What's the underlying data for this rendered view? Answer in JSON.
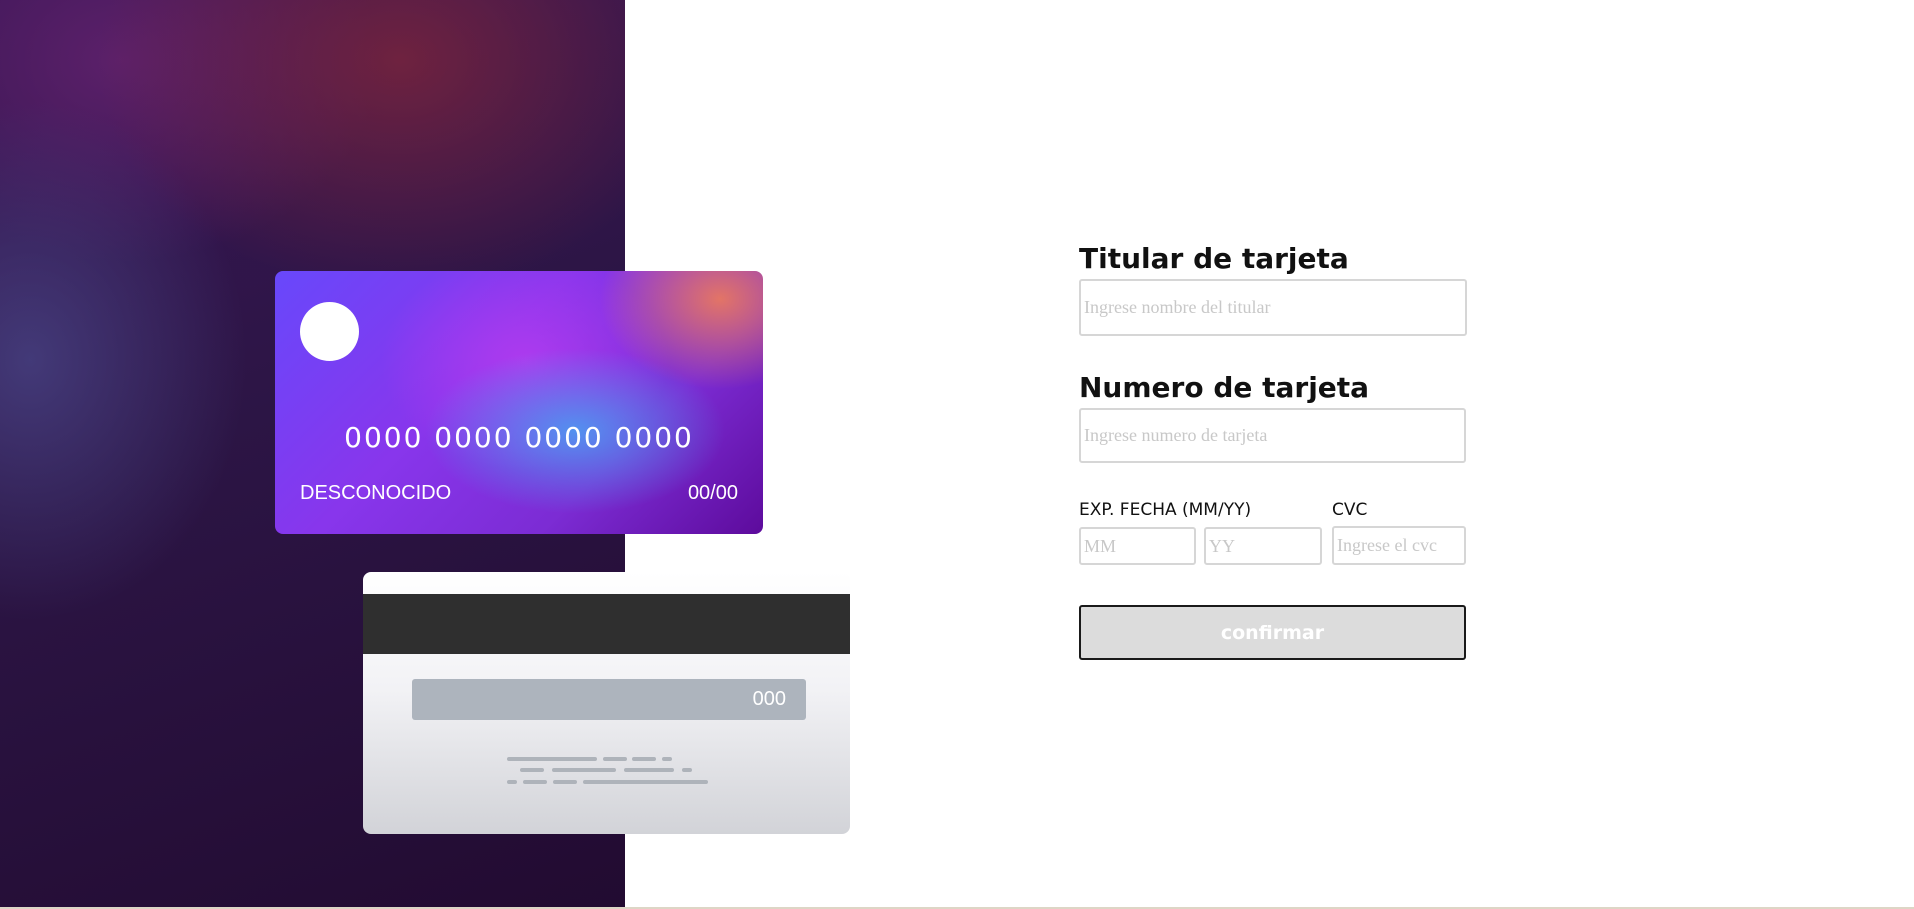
{
  "colors": {
    "card_gradient_start": "#6848fb",
    "card_gradient_end": "#5d0b9c",
    "button_bg": "#dcdcdc",
    "button_text": "#ffffff"
  },
  "card_front": {
    "number": "0000 0000 0000 0000",
    "holder": "DESCONOCIDO",
    "expiry": "00/00"
  },
  "card_back": {
    "cvc": "000"
  },
  "form": {
    "holder_label": "Titular de tarjeta",
    "holder_placeholder": "Ingrese nombre del titular",
    "number_label": "Numero de tarjeta",
    "number_placeholder": "Ingrese numero de tarjeta",
    "exp_label": "EXP. FECHA (MM/YY)",
    "month_placeholder": "MM",
    "year_placeholder": "YY",
    "cvc_label": "CVC",
    "cvc_placeholder": "Ingrese el cvc",
    "confirm_label": "confirmar"
  }
}
